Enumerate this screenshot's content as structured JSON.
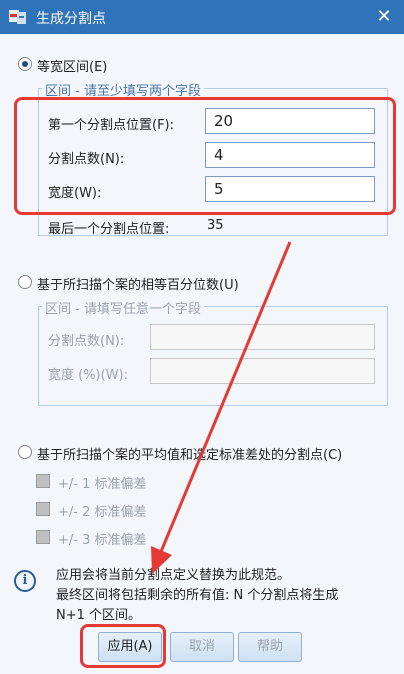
{
  "window": {
    "title": "生成分割点",
    "close_glyph": "✕"
  },
  "option1": {
    "label": "等宽区间(E)",
    "group_title": "区间 - 请至少填写两个字段",
    "first_cut_label": "第一个分割点位置(F):",
    "first_cut_value": "20",
    "num_cuts_label": "分割点数(N):",
    "num_cuts_value": "4",
    "width_label": "宽度(W):",
    "width_value": "5",
    "last_cut_label": "最后一个分割点位置:",
    "last_cut_value": "35"
  },
  "option2": {
    "label": "基于所扫描个案的相等百分位数(U)",
    "group_title": "区间 - 请填写任意一个字段",
    "num_cuts_label": "分割点数(N):",
    "width_label": "宽度 (%)(W):"
  },
  "option3": {
    "label": "基于所扫描个案的平均值和选定标准差处的分割点(C)",
    "sd1": "+/- 1 标准偏差",
    "sd2": "+/- 2 标准偏差",
    "sd3": "+/- 3 标准偏差"
  },
  "info": {
    "line1": "应用会将当前分割点定义替换为此规范。",
    "line2": "最终区间将包括剩余的所有值: N 个分割点将生成",
    "line3": "N+1 个区间。"
  },
  "buttons": {
    "apply": "应用(A)",
    "cancel": "取消",
    "help": "帮助"
  },
  "colors": {
    "titlebar": "#2f73b8",
    "highlight": "#e53935"
  },
  "icons": {
    "app": "app-icon",
    "info": "info-icon"
  }
}
